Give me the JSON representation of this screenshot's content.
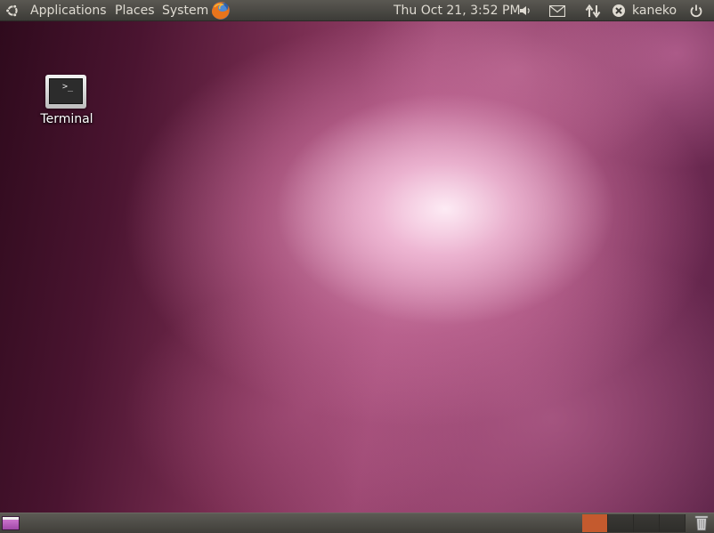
{
  "top_panel": {
    "menus": {
      "applications": "Applications",
      "places": "Places",
      "system": "System"
    },
    "clock": "Thu Oct 21,  3:52 PM",
    "user": "kaneko",
    "icons": {
      "ubuntu_logo": "ubuntu-logo-icon",
      "firefox": "firefox-icon",
      "volume": "volume-icon",
      "mail": "mail-icon",
      "network": "network-icon",
      "me_menu": "me-menu-icon",
      "power": "power-icon"
    }
  },
  "desktop": {
    "launchers": [
      {
        "label": "Terminal",
        "icon": "terminal-icon",
        "prompt": ">_"
      }
    ]
  },
  "bottom_panel": {
    "workspaces": [
      {
        "active": true,
        "color": "#c45a2e"
      },
      {
        "active": false,
        "color": "#3a3935"
      },
      {
        "active": false,
        "color": "#3a3935"
      },
      {
        "active": false,
        "color": "#3a3935"
      }
    ],
    "icons": {
      "show_desktop": "show-desktop-icon",
      "trash": "trash-icon"
    }
  },
  "colors": {
    "panel": "#3c3b37",
    "panel_text": "#dfdbd2",
    "active_workspace": "#c45a2e"
  }
}
